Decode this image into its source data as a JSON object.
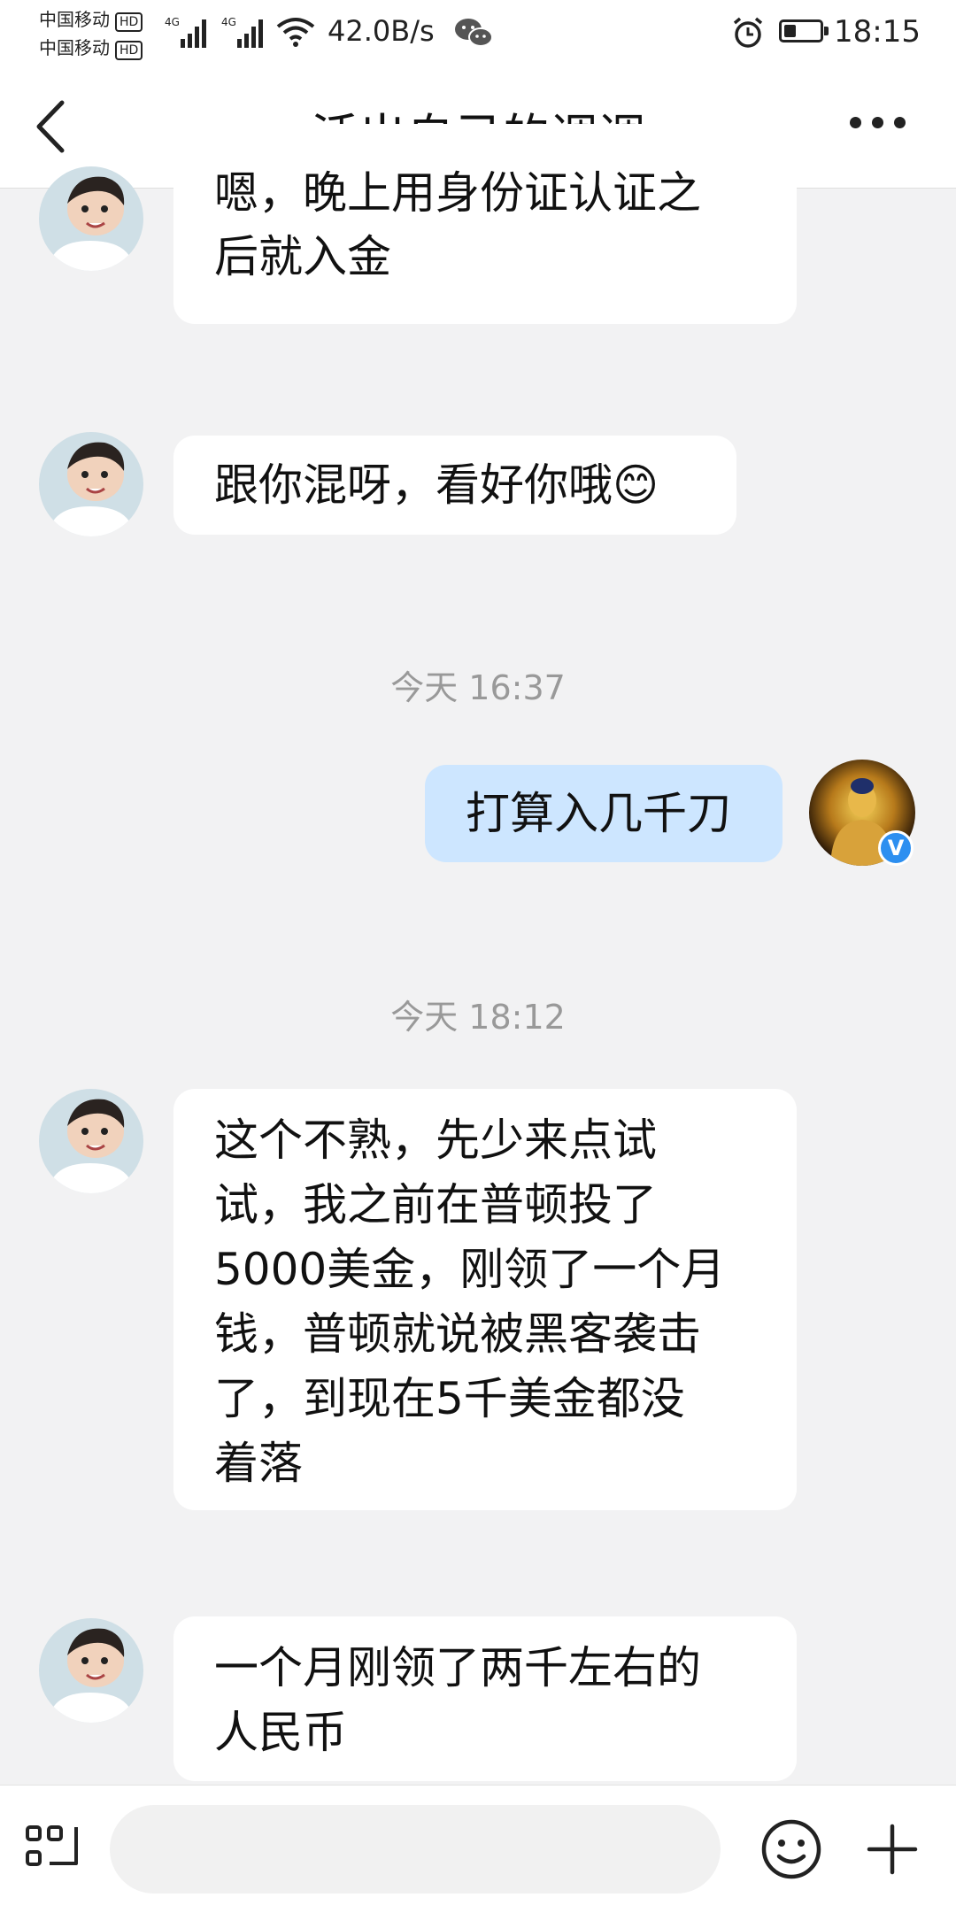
{
  "status_bar": {
    "carrier_1": "中国移动",
    "carrier_2": "中国移动",
    "hd_badge": "HD",
    "network_1": "4G",
    "network_2": "4G",
    "net_speed": "42.0B/s",
    "time": "18:15",
    "battery_level": 0.35
  },
  "header": {
    "title": "活出自己的调调"
  },
  "messages": [
    {
      "direction": "in",
      "text_line1": "嗯，晚上用身份证认证之",
      "text_line2": "后就入金"
    },
    {
      "direction": "in",
      "text": "跟你混呀，看好你哦😊"
    },
    {
      "timestamp": "今天 16:37"
    },
    {
      "direction": "out",
      "text": "打算入几千刀"
    },
    {
      "timestamp": "今天 18:12"
    },
    {
      "direction": "in",
      "lines": [
        "这个不熟，先少来点试",
        "试，我之前在普顿投了",
        "5000美金，刚领了一个月",
        "钱，普顿就说被黑客袭击",
        "了，到现在5千美金都没",
        "着落"
      ]
    },
    {
      "direction": "in",
      "lines": [
        "一个月刚领了两千左右的",
        "人民币"
      ]
    }
  ],
  "verified_badge": "V",
  "input": {
    "placeholder": ""
  },
  "colors": {
    "outgoing_bubble": "#cde6ff",
    "incoming_bubble": "#ffffff",
    "background": "#f2f2f3",
    "verified_blue": "#2d8ff0"
  }
}
